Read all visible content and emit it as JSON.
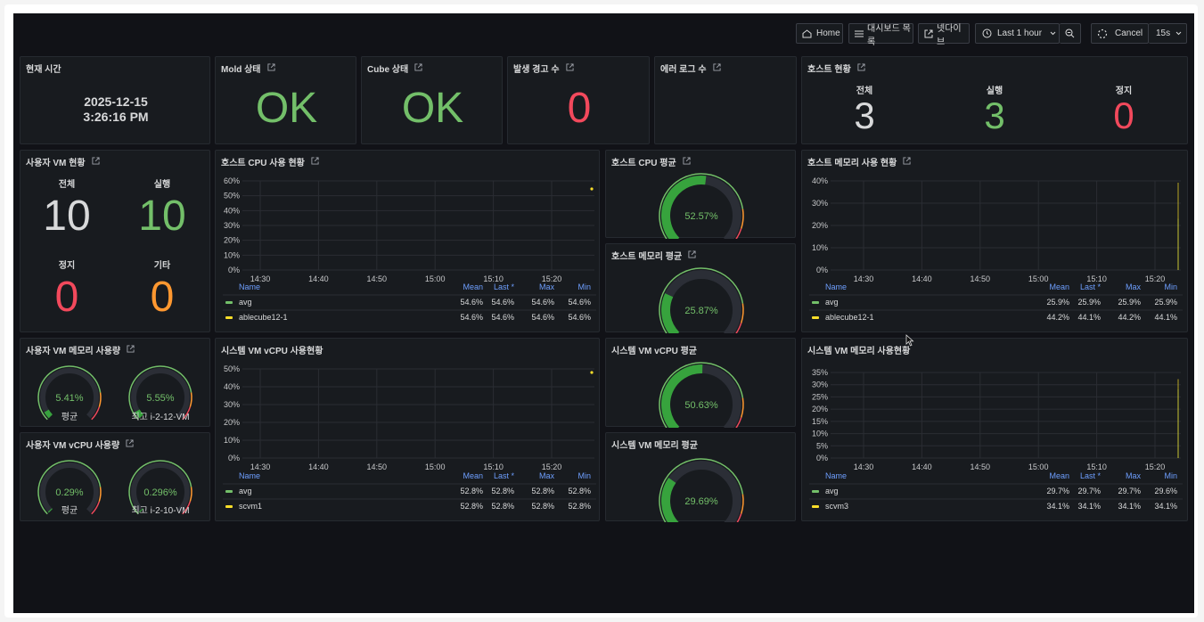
{
  "toolbar": {
    "home_label": "Home",
    "dashboards_label": "대시보드 목록",
    "external_label": "넷다이브",
    "timerange_label": "Last 1 hour",
    "cancel_label": "Cancel",
    "refresh_label": "15s"
  },
  "panels": {
    "current_time": {
      "title": "현재 시간",
      "date": "2025-12-15",
      "time": "3:26:16 PM"
    },
    "mold_status": {
      "title": "Mold 상태",
      "value": "OK"
    },
    "cube_status": {
      "title": "Cube 상태",
      "value": "OK"
    },
    "alerts": {
      "title": "발생 경고 수",
      "value": "0"
    },
    "error_logs": {
      "title": "에러 로그 수"
    },
    "host_status": {
      "title": "호스트 현황",
      "total_label": "전체",
      "total": "3",
      "running_label": "실행",
      "running": "3",
      "stopped_label": "정지",
      "stopped": "0"
    },
    "user_vm_status": {
      "title": "사용자 VM 현황",
      "total_label": "전체",
      "total": "10",
      "running_label": "실행",
      "running": "10",
      "stopped_label": "정지",
      "stopped": "0",
      "other_label": "기타",
      "other": "0"
    },
    "host_cpu_avg": {
      "title": "호스트 CPU 평균",
      "value": "52.57%",
      "percent": 52.57
    },
    "host_mem_avg": {
      "title": "호스트 메모리 평균",
      "value": "25.87%",
      "percent": 25.87
    },
    "sys_vcpu_avg": {
      "title": "시스템 VM vCPU 평균",
      "value": "50.63%",
      "percent": 50.63
    },
    "sys_mem_avg": {
      "title": "시스템 VM 메모리 평균",
      "value": "29.69%",
      "percent": 29.69
    },
    "user_vm_mem": {
      "title": "사용자 VM 메모리 사용량",
      "g1_value": "5.41%",
      "g1_percent": 5.41,
      "g1_label": "평균",
      "g2_value": "5.55%",
      "g2_percent": 5.55,
      "g2_label": "최고 i-2-12-VM"
    },
    "user_vm_vcpu": {
      "title": "사용자 VM vCPU 사용량",
      "g1_value": "0.29%",
      "g1_percent": 0.29,
      "g1_label": "평균",
      "g2_value": "0.296%",
      "g2_percent": 0.296,
      "g2_label": "최고 i-2-10-VM"
    }
  },
  "chart_data": [
    {
      "id": "host_cpu",
      "title": "호스트 CPU 사용 현황",
      "type": "line",
      "x": [
        "14:30",
        "14:40",
        "14:50",
        "15:00",
        "15:10",
        "15:20"
      ],
      "y_ticks": [
        "60%",
        "50%",
        "40%",
        "30%",
        "20%",
        "10%",
        "0%"
      ],
      "ylim": [
        0,
        60
      ],
      "legend_headers": {
        "name": "Name",
        "mean": "Mean",
        "last": "Last *",
        "max": "Max",
        "min": "Min"
      },
      "series": [
        {
          "name": "avg",
          "color": "#73bf69",
          "mean": "54.6%",
          "last": "54.6%",
          "max": "54.6%",
          "min": "54.6%"
        },
        {
          "name": "ablecube12-1",
          "color": "#fade2a",
          "mean": "54.6%",
          "last": "54.6%",
          "max": "54.6%",
          "min": "54.6%"
        }
      ],
      "last_point": {
        "x": "15:26",
        "y": 54.6
      }
    },
    {
      "id": "host_mem",
      "title": "호스트 메모리 사용 현황",
      "type": "line",
      "x": [
        "14:30",
        "14:40",
        "14:50",
        "15:00",
        "15:10",
        "15:20"
      ],
      "y_ticks": [
        "40%",
        "30%",
        "20%",
        "10%",
        "0%"
      ],
      "ylim": [
        0,
        45
      ],
      "legend_headers": {
        "name": "Name",
        "mean": "Mean",
        "last": "Last *",
        "max": "Max",
        "min": "Min"
      },
      "series": [
        {
          "name": "avg",
          "color": "#73bf69",
          "mean": "25.9%",
          "last": "25.9%",
          "max": "25.9%",
          "min": "25.9%"
        },
        {
          "name": "ablecube12-1",
          "color": "#fade2a",
          "mean": "44.2%",
          "last": "44.1%",
          "max": "44.2%",
          "min": "44.1%"
        }
      ]
    },
    {
      "id": "sys_vcpu",
      "title": "시스템 VM vCPU 사용현황",
      "type": "line",
      "x": [
        "14:30",
        "14:40",
        "14:50",
        "15:00",
        "15:10",
        "15:20"
      ],
      "y_ticks": [
        "50%",
        "40%",
        "30%",
        "20%",
        "10%",
        "0%"
      ],
      "ylim": [
        0,
        55
      ],
      "legend_headers": {
        "name": "Name",
        "mean": "Mean",
        "last": "Last *",
        "max": "Max",
        "min": "Min"
      },
      "series": [
        {
          "name": "avg",
          "color": "#73bf69",
          "mean": "52.8%",
          "last": "52.8%",
          "max": "52.8%",
          "min": "52.8%"
        },
        {
          "name": "scvm1",
          "color": "#fade2a",
          "mean": "52.8%",
          "last": "52.8%",
          "max": "52.8%",
          "min": "52.8%"
        }
      ],
      "last_point": {
        "x": "15:26",
        "y": 52.8
      }
    },
    {
      "id": "sys_mem",
      "title": "시스템 VM 메모리 사용현황",
      "type": "line",
      "x": [
        "14:30",
        "14:40",
        "14:50",
        "15:00",
        "15:10",
        "15:20"
      ],
      "y_ticks": [
        "35%",
        "30%",
        "25%",
        "20%",
        "15%",
        "10%",
        "5%",
        "0%"
      ],
      "ylim": [
        0,
        37
      ],
      "legend_headers": {
        "name": "Name",
        "mean": "Mean",
        "last": "Last *",
        "max": "Max",
        "min": "Min"
      },
      "series": [
        {
          "name": "avg",
          "color": "#73bf69",
          "mean": "29.7%",
          "last": "29.7%",
          "max": "29.7%",
          "min": "29.6%"
        },
        {
          "name": "scvm3",
          "color": "#fade2a",
          "mean": "34.1%",
          "last": "34.1%",
          "max": "34.1%",
          "min": "34.1%"
        }
      ]
    }
  ]
}
